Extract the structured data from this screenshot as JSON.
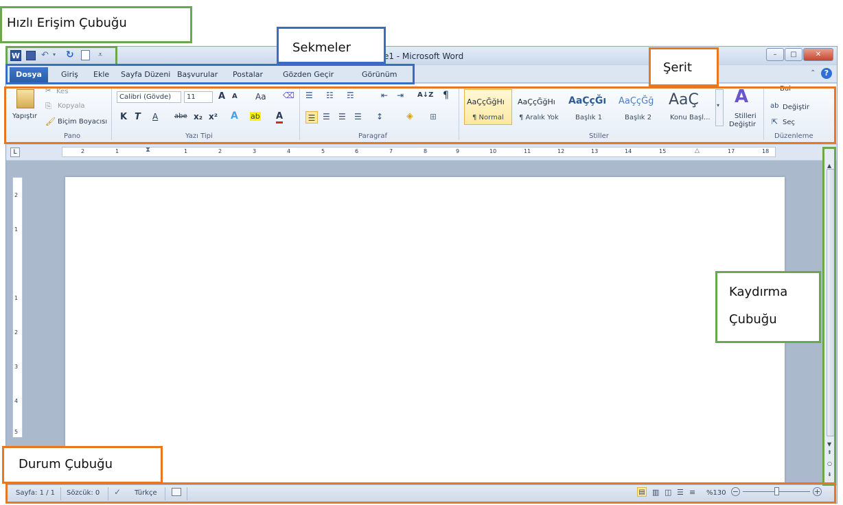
{
  "window": {
    "title": "lge1 - Microsoft Word"
  },
  "quick_access": {
    "icons": [
      "word-logo-icon",
      "save-icon",
      "undo-icon",
      "redo-icon",
      "print-preview-icon",
      "customize-icon"
    ]
  },
  "tabs": [
    {
      "label": "Dosya"
    },
    {
      "label": "Giriş"
    },
    {
      "label": "Ekle"
    },
    {
      "label": "Sayfa Düzeni"
    },
    {
      "label": "Başvurular"
    },
    {
      "label": "Postalar"
    },
    {
      "label": "Gözden Geçir"
    },
    {
      "label": "Görünüm"
    }
  ],
  "ribbon": {
    "clipboard": {
      "paste": "Yapıştır",
      "cut": "Kes",
      "copy": "Kopyala",
      "format_painter": "Biçim Boyacısı",
      "group": "Pano"
    },
    "font": {
      "name": "Calibri (Gövde)",
      "size": "11",
      "grow": "A",
      "shrink": "A",
      "case": "Aa",
      "bold": "K",
      "italic": "T",
      "underline": "A",
      "strike": "abe",
      "sub": "x₂",
      "sup": "x²",
      "highlight": "ab",
      "color": "A",
      "group": "Yazı Tipi"
    },
    "paragraph": {
      "sort": "A↓Z",
      "pilcrow": "¶",
      "group": "Paragraf"
    },
    "styles": {
      "items": [
        {
          "sample": "AaÇçĞğHı",
          "name": "¶ Normal"
        },
        {
          "sample": "AaÇçĞğHı",
          "name": "¶ Aralık Yok"
        },
        {
          "sample": "AaÇçĞı",
          "name": "Başlık 1"
        },
        {
          "sample": "AaÇçĞğ",
          "name": "Başlık 2"
        },
        {
          "sample": "AaÇ",
          "name": "Konu Başl..."
        }
      ],
      "change_line1": "Stilleri",
      "change_line2": "Değiştir",
      "group": "Stiller"
    },
    "editing": {
      "find": "Bul",
      "replace": "Değiştir",
      "select": "Seç",
      "group": "Düzenleme"
    }
  },
  "ruler": {
    "marks": [
      "2",
      "1",
      "1",
      "2",
      "3",
      "4",
      "5",
      "6",
      "7",
      "8",
      "9",
      "10",
      "11",
      "12",
      "13",
      "14",
      "15",
      "17",
      "18"
    ],
    "vmarks": [
      "2",
      "1",
      "1",
      "2",
      "3",
      "4",
      "5"
    ]
  },
  "status": {
    "page": "Sayfa: 1 / 1",
    "words": "Sözcük: 0",
    "language": "Türkçe",
    "zoom": "%130"
  },
  "callouts": {
    "quick_access": "Hızlı Erişim Çubuğu",
    "tabs": "Sekmeler",
    "ribbon": "Şerit",
    "scrollbar_line1": "Kaydırma",
    "scrollbar_line2": "Çubuğu",
    "statusbar": "Durum Çubuğu"
  },
  "colors": {
    "green": "#6aa84f",
    "blue": "#3a6cc4",
    "orange": "#e87722"
  }
}
